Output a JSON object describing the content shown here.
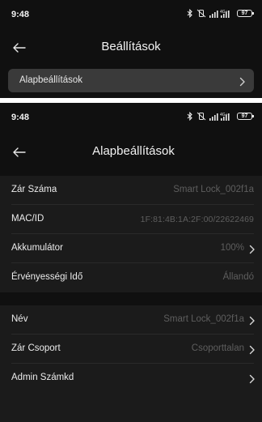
{
  "screens": [
    {
      "status": {
        "time": "9:48",
        "battery": "97",
        "network": "4G+"
      },
      "nav": {
        "title": "Beállítások"
      },
      "rows": [
        {
          "label": "Alapbeállítások"
        }
      ]
    },
    {
      "status": {
        "time": "9:48",
        "battery": "97",
        "network": "4G+"
      },
      "nav": {
        "title": "Alapbeállítások"
      },
      "group1": [
        {
          "label": "Zár Száma",
          "value": "Smart Lock_002f1a",
          "chevron": false
        },
        {
          "label": "MAC/ID",
          "value": "1F:81:4B:1A:2F:00/22622469",
          "chevron": false
        },
        {
          "label": "Akkumulátor",
          "value": "100%",
          "chevron": true
        },
        {
          "label": "Érvényességi Idő",
          "value": "Állandó",
          "chevron": false
        }
      ],
      "group2": [
        {
          "label": "Név",
          "value": "Smart Lock_002f1a",
          "chevron": true
        },
        {
          "label": "Zár Csoport",
          "value": "Csoporttalan",
          "chevron": true
        },
        {
          "label": "Admin Számkd",
          "value": "",
          "chevron": true
        }
      ]
    }
  ],
  "icons": {
    "back": "arrow-left-icon",
    "chevron": "chevron-right-icon",
    "bluetooth": "bluetooth-icon",
    "mute": "vibrate-off-icon",
    "signal": "signal-icon",
    "battery": "battery-icon"
  },
  "colors": {
    "background": "#101010",
    "group": "#1b1b1b",
    "card": "#3a3a3a",
    "muted_value": "#5e5e5e"
  }
}
